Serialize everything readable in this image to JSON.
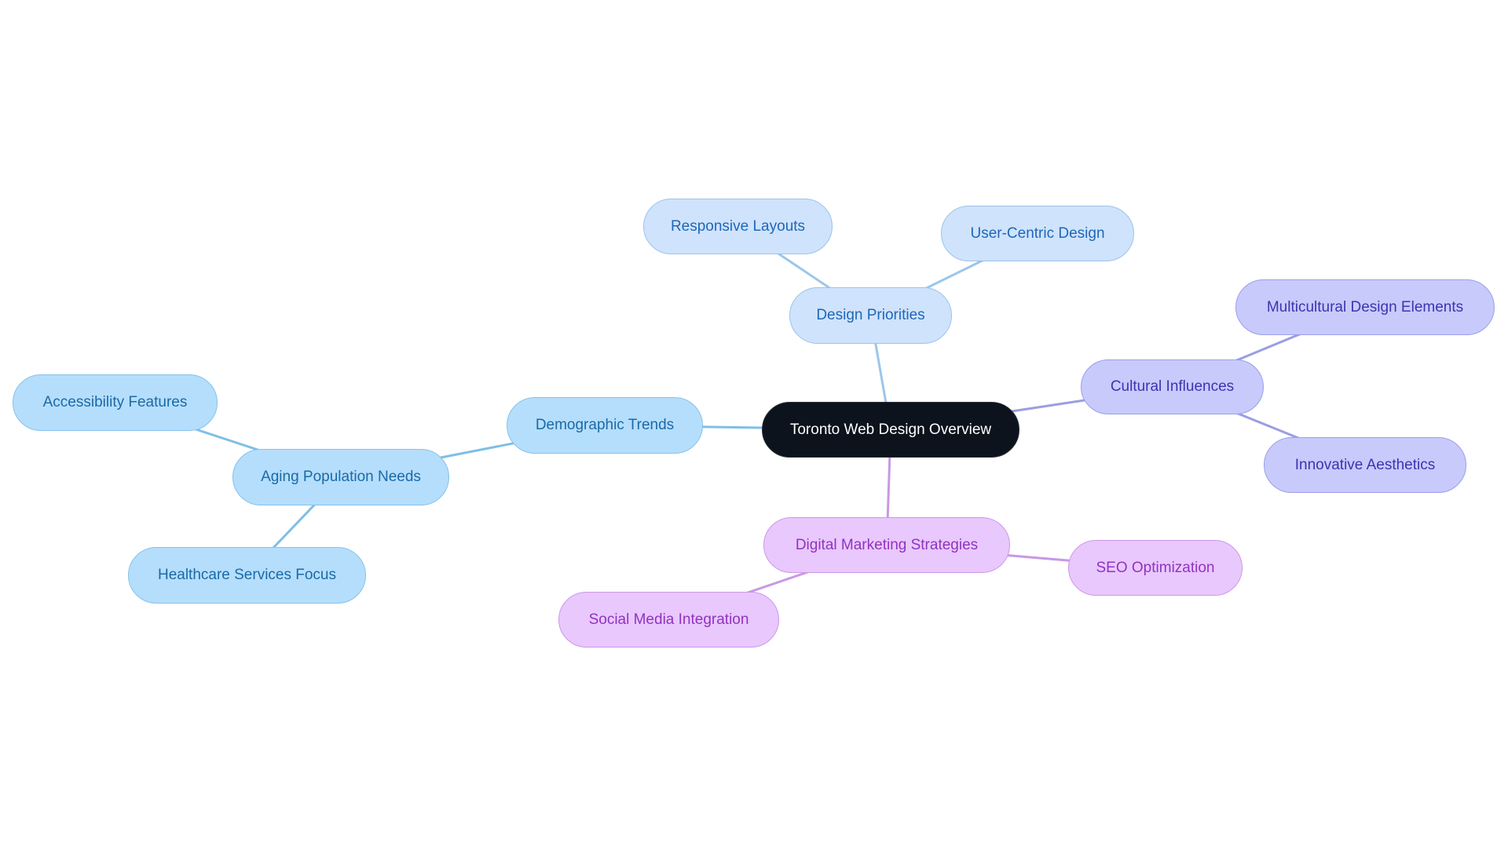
{
  "diagram": {
    "type": "mindmap",
    "root": {
      "id": "root",
      "label": "Toronto Web Design Overview"
    },
    "nodes": [
      {
        "id": "root",
        "label": "Toronto Web Design Overview",
        "style": "root"
      },
      {
        "id": "design-priorities",
        "label": "Design Priorities",
        "parent": "root",
        "style": "blue1"
      },
      {
        "id": "responsive-layouts",
        "label": "Responsive Layouts",
        "parent": "design-priorities",
        "style": "blue1"
      },
      {
        "id": "user-centric-design",
        "label": "User-Centric Design",
        "parent": "design-priorities",
        "style": "blue1"
      },
      {
        "id": "cultural-influences",
        "label": "Cultural Influences",
        "parent": "root",
        "style": "indigo"
      },
      {
        "id": "multicultural-design-elements",
        "label": "Multicultural Design Elements",
        "parent": "cultural-influences",
        "style": "indigo"
      },
      {
        "id": "innovative-aesthetics",
        "label": "Innovative Aesthetics",
        "parent": "cultural-influences",
        "style": "indigo"
      },
      {
        "id": "digital-marketing-strategies",
        "label": "Digital Marketing Strategies",
        "parent": "root",
        "style": "purple"
      },
      {
        "id": "seo-optimization",
        "label": "SEO Optimization",
        "parent": "digital-marketing-strategies",
        "style": "purple"
      },
      {
        "id": "social-media-integration",
        "label": "Social Media Integration",
        "parent": "digital-marketing-strategies",
        "style": "purple"
      },
      {
        "id": "demographic-trends",
        "label": "Demographic Trends",
        "parent": "root",
        "style": "blue2"
      },
      {
        "id": "aging-population-needs",
        "label": "Aging Population Needs",
        "parent": "demographic-trends",
        "style": "blue2"
      },
      {
        "id": "accessibility-features",
        "label": "Accessibility Features",
        "parent": "aging-population-needs",
        "style": "blue2"
      },
      {
        "id": "healthcare-services-focus",
        "label": "Healthcare Services Focus",
        "parent": "aging-population-needs",
        "style": "blue2"
      }
    ],
    "colors": {
      "root_fill": "#0c131c",
      "design_branch": "#cfe3fc",
      "demographic_branch": "#b5defc",
      "cultural_branch": "#c8cafc",
      "marketing_branch": "#e9c8fd"
    }
  }
}
